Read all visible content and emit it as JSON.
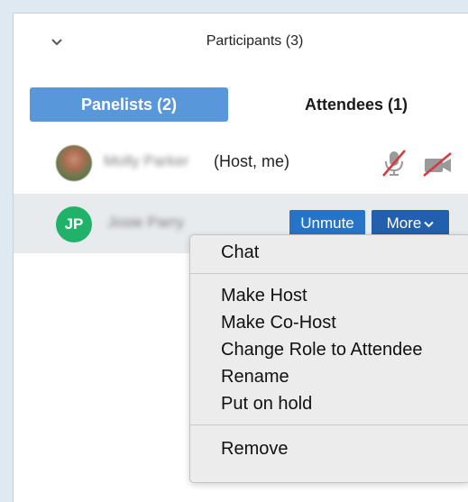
{
  "header": {
    "title": "Participants (3)",
    "collapse_icon": "chevron-down-icon"
  },
  "tabs": [
    {
      "label": "Panelists (2)",
      "active": true
    },
    {
      "label": "Attendees (1)",
      "active": false
    }
  ],
  "participants": [
    {
      "name": "Molly Parker",
      "role": "(Host, me)",
      "avatar": "photo",
      "mic": "mic-muted-icon",
      "camera": "camera-off-icon"
    },
    {
      "name": "Josie Parry",
      "initials": "JP",
      "avatar_color": "#21b26a",
      "unmute_label": "Unmute",
      "more_label": "More"
    }
  ],
  "context_menu": {
    "items": [
      "Chat",
      "Make Host",
      "Make Co-Host",
      "Change Role to Attendee",
      "Rename",
      "Put on hold",
      "Remove"
    ]
  },
  "colors": {
    "accent": "#5897da",
    "button": "#2773c6",
    "muted_red": "#d9363e",
    "highlight_row": "#e8ebee"
  }
}
